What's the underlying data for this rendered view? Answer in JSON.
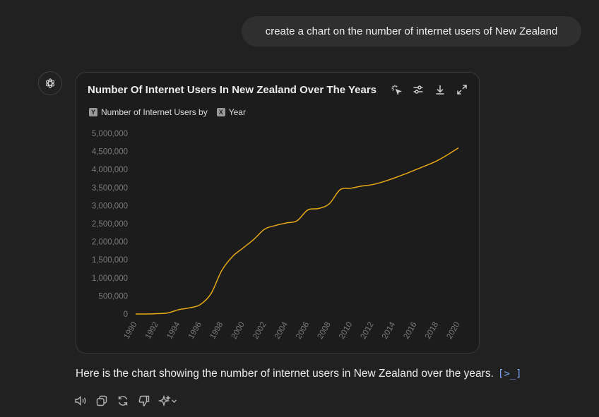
{
  "user_message": "create a chart on the number of internet users of New Zealand",
  "chart_card": {
    "tools": [
      "interactive-icon",
      "settings-sliders-icon",
      "download-icon",
      "expand-icon"
    ],
    "legend": {
      "y_key": "Y",
      "y_label": "Number of Internet Users by",
      "x_key": "X",
      "x_label": "Year"
    }
  },
  "chart_data": {
    "type": "line",
    "title": "Number Of Internet Users In New Zealand Over The Years",
    "xlabel": "Year",
    "ylabel": "Number of Internet Users",
    "x": [
      1990,
      1991,
      1992,
      1993,
      1994,
      1995,
      1996,
      1997,
      1998,
      1999,
      2000,
      2001,
      2002,
      2003,
      2004,
      2005,
      2006,
      2007,
      2008,
      2009,
      2010,
      2011,
      2012,
      2013,
      2014,
      2015,
      2016,
      2017,
      2018,
      2019,
      2020
    ],
    "series": [
      {
        "name": "Number of Internet Users",
        "color": "#e6a817",
        "values": [
          0,
          0,
          10000,
          30000,
          120000,
          170000,
          260000,
          560000,
          1200000,
          1590000,
          1830000,
          2070000,
          2350000,
          2450000,
          2520000,
          2580000,
          2880000,
          2920000,
          3050000,
          3440000,
          3480000,
          3540000,
          3580000,
          3660000,
          3760000,
          3870000,
          3990000,
          4110000,
          4240000,
          4410000,
          4600000
        ]
      }
    ],
    "y_ticks": [
      "5,000,000",
      "4,500,000",
      "4,000,000",
      "3,500,000",
      "3,000,000",
      "2,500,000",
      "2,000,000",
      "1,500,000",
      "1,000,000",
      "500,000",
      "0"
    ],
    "x_ticks": [
      "1990",
      "1992",
      "1994",
      "1996",
      "1998",
      "2000",
      "2002",
      "2004",
      "2006",
      "2008",
      "2010",
      "2012",
      "2014",
      "2016",
      "2018",
      "2020"
    ],
    "ylim": [
      0,
      5000000
    ],
    "grid": false,
    "legend": "top-left"
  },
  "response_text": "Here is the chart showing the number of internet users in New Zealand over the years.",
  "citation_label": "[>_]",
  "actions": [
    "read-aloud-icon",
    "copy-icon",
    "regenerate-icon",
    "thumbs-down-icon",
    "sparkle-model-icon"
  ]
}
